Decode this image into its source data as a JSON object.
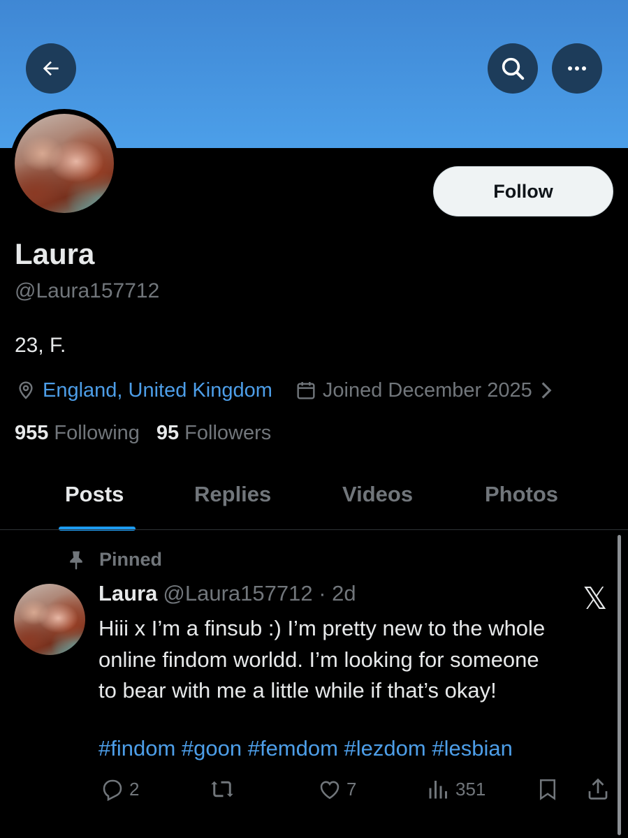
{
  "header": {
    "back_icon": "arrow-left-icon",
    "search_icon": "search-icon",
    "more_icon": "more-dots-icon"
  },
  "profile": {
    "follow_label": "Follow",
    "name": "Laura",
    "handle": "@Laura157712",
    "bio": "23, F.",
    "location": "England, United Kingdom",
    "joined": "Joined December 2025",
    "following_count": "955",
    "following_label": "Following",
    "followers_count": "95",
    "followers_label": "Followers"
  },
  "tabs": [
    {
      "label": "Posts"
    },
    {
      "label": "Replies"
    },
    {
      "label": "Videos"
    },
    {
      "label": "Photos"
    }
  ],
  "post": {
    "pinned_label": "Pinned",
    "author": "Laura",
    "handle_time": "@Laura157712 · 2d",
    "x_logo": "𝕏",
    "text": "Hiii x I’m a finsub :) I’m pretty new to the whole\nonline findom worldd. I’m looking for someone\nto bear with me a little while if that’s okay!",
    "hashtags": "#findom #goon #femdom #lezdom #lesbian",
    "replies": "2",
    "likes": "7",
    "views": "351"
  },
  "colors": {
    "banner": "#4c9fe9",
    "accent": "#1d9bf0",
    "link": "#4d9ee8",
    "muted": "#71767b",
    "text": "#e7e9ea"
  }
}
